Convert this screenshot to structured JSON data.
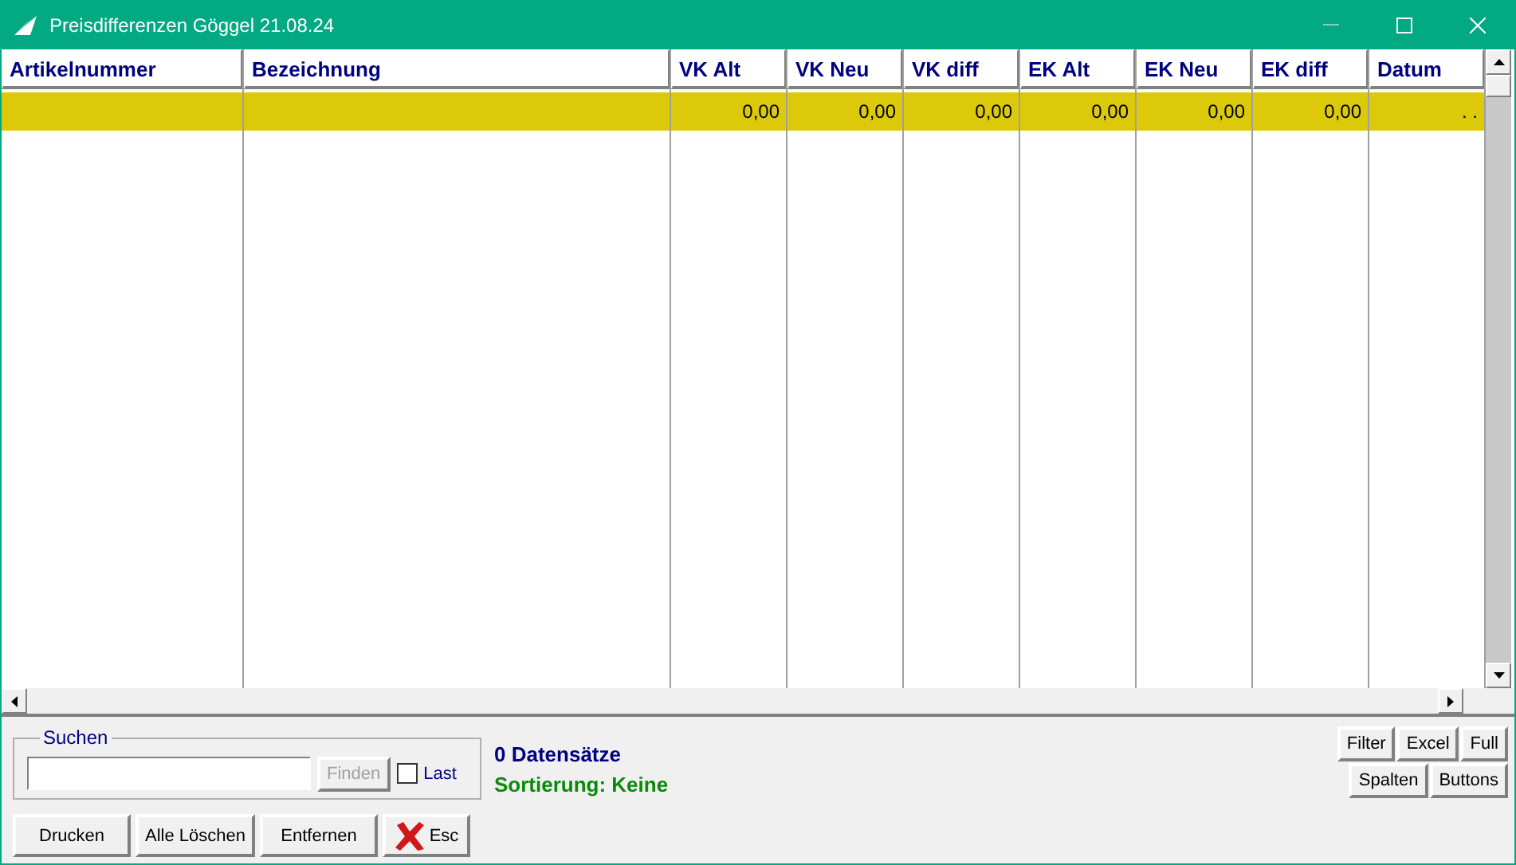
{
  "window": {
    "title": "Preisdifferenzen Göggel 21.08.24"
  },
  "table": {
    "columns": [
      "Artikelnummer",
      "Bezeichnung",
      "VK Alt",
      "VK Neu",
      "VK diff",
      "EK Alt",
      "EK Neu",
      "EK diff",
      "Datum"
    ],
    "rows": [
      {
        "selected": true,
        "cells": [
          null,
          null,
          "0,00",
          "0,00",
          "0,00",
          "0,00",
          "0,00",
          "0,00",
          ".  ."
        ]
      }
    ]
  },
  "search": {
    "label": "Suchen",
    "find_button": {
      "label": "Finden",
      "disabled": true
    },
    "last": {
      "label": "Last",
      "checked": false
    }
  },
  "status": {
    "count": "0 Datensätze",
    "sorting": "Sortierung: Keine"
  },
  "tool_buttons": [
    [
      "Filter",
      "Excel",
      "Full"
    ],
    [
      "Spalten",
      "Buttons"
    ]
  ],
  "buttons": [
    {
      "label": "Drucken",
      "kind": "text"
    },
    {
      "label": "Alle Löschen",
      "kind": "text"
    },
    {
      "label": "Entfernen",
      "kind": "text"
    },
    {
      "label": "Esc",
      "kind": "cancel"
    }
  ]
}
